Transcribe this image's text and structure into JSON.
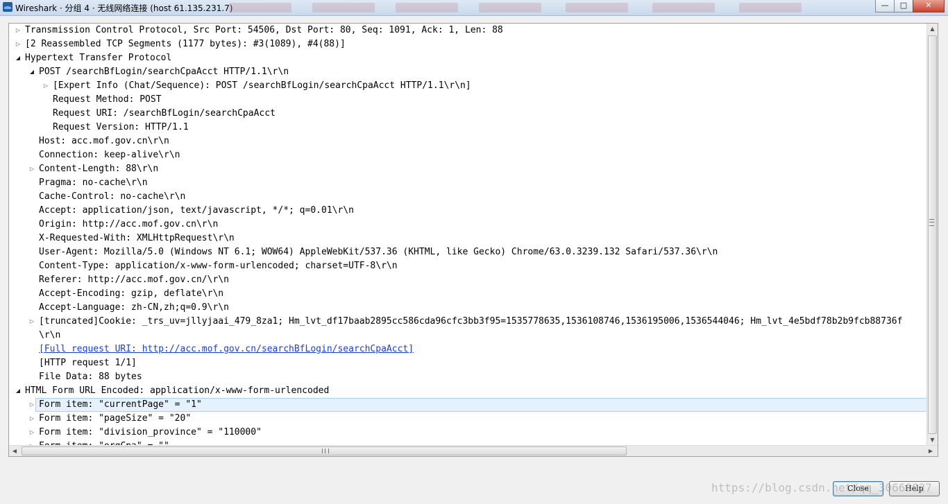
{
  "window": {
    "title": "Wireshark · 分组 4 · 无线网络连接 (host 61.135.231.7)",
    "minimize_glyph": "—",
    "maximize_glyph": "□",
    "close_glyph": "✕"
  },
  "glyphs": {
    "collapsed": "▷",
    "expanded": "◢",
    "scroll_up": "▲",
    "scroll_down": "▼",
    "scroll_left": "◀",
    "scroll_right": "▶"
  },
  "tree_rows": [
    {
      "depth": 0,
      "expander": "collapsed",
      "text": "Transmission Control Protocol, Src Port: 54506, Dst Port: 80, Seq: 1091, Ack: 1, Len: 88"
    },
    {
      "depth": 0,
      "expander": "collapsed",
      "text": "[2 Reassembled TCP Segments (1177 bytes): #3(1089), #4(88)]"
    },
    {
      "depth": 0,
      "expander": "expanded",
      "text": "Hypertext Transfer Protocol",
      "state": "selected"
    },
    {
      "depth": 1,
      "expander": "expanded",
      "text": "POST /searchBfLogin/searchCpaAcct HTTP/1.1\\r\\n",
      "state": "selected"
    },
    {
      "depth": 2,
      "expander": "collapsed",
      "text": "[Expert Info (Chat/Sequence): POST /searchBfLogin/searchCpaAcct HTTP/1.1\\r\\n]"
    },
    {
      "depth": 2,
      "expander": "none",
      "text": "Request Method: POST"
    },
    {
      "depth": 2,
      "expander": "none",
      "text": "Request URI: /searchBfLogin/searchCpaAcct"
    },
    {
      "depth": 2,
      "expander": "none",
      "text": "Request Version: HTTP/1.1"
    },
    {
      "depth": 1,
      "expander": "none",
      "text": "Host: acc.mof.gov.cn\\r\\n"
    },
    {
      "depth": 1,
      "expander": "none",
      "text": "Connection: keep-alive\\r\\n"
    },
    {
      "depth": 1,
      "expander": "collapsed",
      "text": "Content-Length: 88\\r\\n"
    },
    {
      "depth": 1,
      "expander": "none",
      "text": "Pragma: no-cache\\r\\n"
    },
    {
      "depth": 1,
      "expander": "none",
      "text": "Cache-Control: no-cache\\r\\n"
    },
    {
      "depth": 1,
      "expander": "none",
      "text": "Accept: application/json, text/javascript, */*; q=0.01\\r\\n"
    },
    {
      "depth": 1,
      "expander": "none",
      "text": "Origin: http://acc.mof.gov.cn\\r\\n"
    },
    {
      "depth": 1,
      "expander": "none",
      "text": "X-Requested-With: XMLHttpRequest\\r\\n"
    },
    {
      "depth": 1,
      "expander": "none",
      "text": "User-Agent: Mozilla/5.0 (Windows NT 6.1; WOW64) AppleWebKit/537.36 (KHTML, like Gecko) Chrome/63.0.3239.132 Safari/537.36\\r\\n"
    },
    {
      "depth": 1,
      "expander": "none",
      "text": "Content-Type: application/x-www-form-urlencoded; charset=UTF-8\\r\\n"
    },
    {
      "depth": 1,
      "expander": "none",
      "text": "Referer: http://acc.mof.gov.cn/\\r\\n"
    },
    {
      "depth": 1,
      "expander": "none",
      "text": "Accept-Encoding: gzip, deflate\\r\\n"
    },
    {
      "depth": 1,
      "expander": "none",
      "text": "Accept-Language: zh-CN,zh;q=0.9\\r\\n"
    },
    {
      "depth": 1,
      "expander": "collapsed",
      "text": " [truncated]Cookie: _trs_uv=jllyjaai_479_8za1; Hm_lvt_df17baab2895cc586cda96cfc3bb3f95=1535778635,1536108746,1536195006,1536544046; Hm_lvt_4e5bdf78b2b9fcb88736f"
    },
    {
      "depth": 1,
      "expander": "none",
      "text": "\\r\\n"
    },
    {
      "depth": 1,
      "expander": "none",
      "text": "[Full request URI: http://acc.mof.gov.cn/searchBfLogin/searchCpaAcct]",
      "link": true
    },
    {
      "depth": 1,
      "expander": "none",
      "text": "[HTTP request 1/1]"
    },
    {
      "depth": 1,
      "expander": "none",
      "text": "File Data: 88 bytes"
    },
    {
      "depth": 0,
      "expander": "expanded",
      "text": "HTML Form URL Encoded: application/x-www-form-urlencoded"
    },
    {
      "depth": 1,
      "expander": "collapsed",
      "text": "Form item: \"currentPage\" = \"1\"",
      "state": "hover"
    },
    {
      "depth": 1,
      "expander": "collapsed",
      "text": "Form item: \"pageSize\" = \"20\""
    },
    {
      "depth": 1,
      "expander": "collapsed",
      "text": "Form item: \"division_province\" = \"110000\""
    },
    {
      "depth": 1,
      "expander": "collapsed",
      "text": "Form item: \"orgCpa\" = \"\""
    }
  ],
  "buttons": {
    "close_label": "Close",
    "help_label": "Help"
  },
  "watermark": "https://blog.csdn.net/qq_30660027",
  "colors": {
    "selection": "#8fbef5",
    "hover": "#e5f1fd",
    "link": "#1a3fd6"
  }
}
